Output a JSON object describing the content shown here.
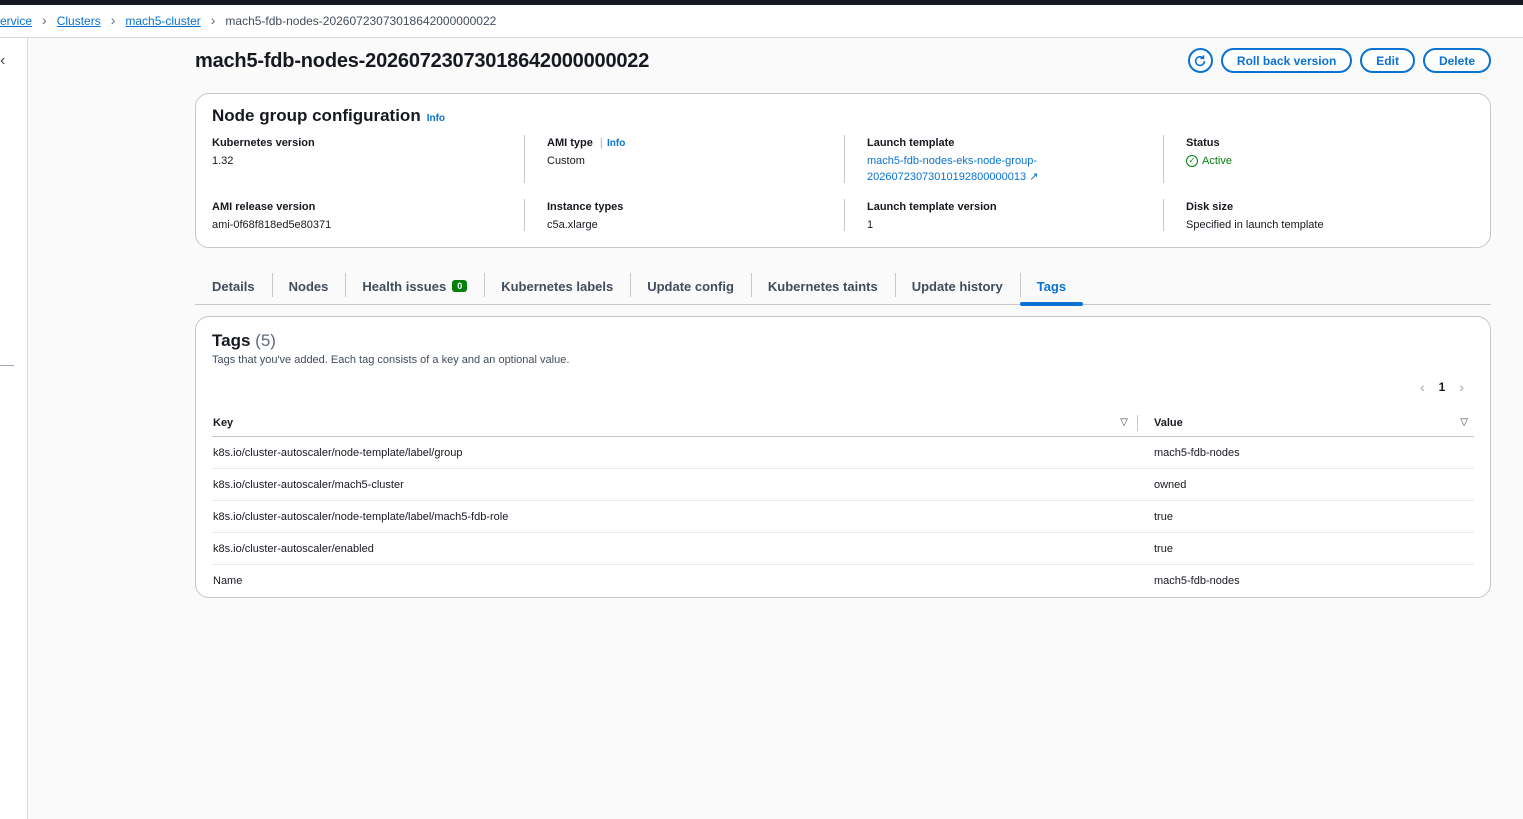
{
  "breadcrumbs": [
    {
      "label": "ervice",
      "link": true
    },
    {
      "label": "Clusters",
      "link": true
    },
    {
      "label": "mach5-cluster",
      "link": true
    },
    {
      "label": "mach5-fdb-nodes-20260723073018642000000022",
      "link": false
    }
  ],
  "page": {
    "title": "mach5-fdb-nodes-20260723073018642000000022",
    "actions": {
      "refresh_icon": "refresh-icon",
      "rollback": "Roll back version",
      "edit": "Edit",
      "delete": "Delete"
    }
  },
  "config": {
    "title": "Node group configuration",
    "info": "Info",
    "kubernetes_version": {
      "label": "Kubernetes version",
      "value": "1.32"
    },
    "ami_type": {
      "label": "AMI type",
      "info": "Info",
      "value": "Custom"
    },
    "launch_template": {
      "label": "Launch template",
      "value_line1": "mach5-fdb-nodes-eks-node-group-",
      "value_line2": "20260723073010192800000013"
    },
    "status": {
      "label": "Status",
      "value": "Active"
    },
    "ami_release": {
      "label": "AMI release version",
      "value": "ami-0f68f818ed5e80371"
    },
    "instance_types": {
      "label": "Instance types",
      "value": "c5a.xlarge"
    },
    "launch_template_version": {
      "label": "Launch template version",
      "value": "1"
    },
    "disk_size": {
      "label": "Disk size",
      "value": "Specified in launch template"
    }
  },
  "tabs": [
    {
      "label": "Details"
    },
    {
      "label": "Nodes"
    },
    {
      "label": "Health issues",
      "badge": "0"
    },
    {
      "label": "Kubernetes labels"
    },
    {
      "label": "Update config"
    },
    {
      "label": "Kubernetes taints"
    },
    {
      "label": "Update history"
    },
    {
      "label": "Tags",
      "active": true
    }
  ],
  "tags": {
    "title": "Tags",
    "count": "(5)",
    "description": "Tags that you've added. Each tag consists of a key and an optional value.",
    "page": "1",
    "columns": {
      "key": "Key",
      "value": "Value"
    },
    "rows": [
      {
        "key": "k8s.io/cluster-autoscaler/node-template/label/group",
        "value": "mach5-fdb-nodes"
      },
      {
        "key": "k8s.io/cluster-autoscaler/mach5-cluster",
        "value": "owned"
      },
      {
        "key": "k8s.io/cluster-autoscaler/node-template/label/mach5-fdb-role",
        "value": "true"
      },
      {
        "key": "k8s.io/cluster-autoscaler/enabled",
        "value": "true"
      },
      {
        "key": "Name",
        "value": "mach5-fdb-nodes"
      }
    ]
  },
  "colors": {
    "link": "#0972d3",
    "success": "#037f0c",
    "border": "#c6c6cd"
  }
}
